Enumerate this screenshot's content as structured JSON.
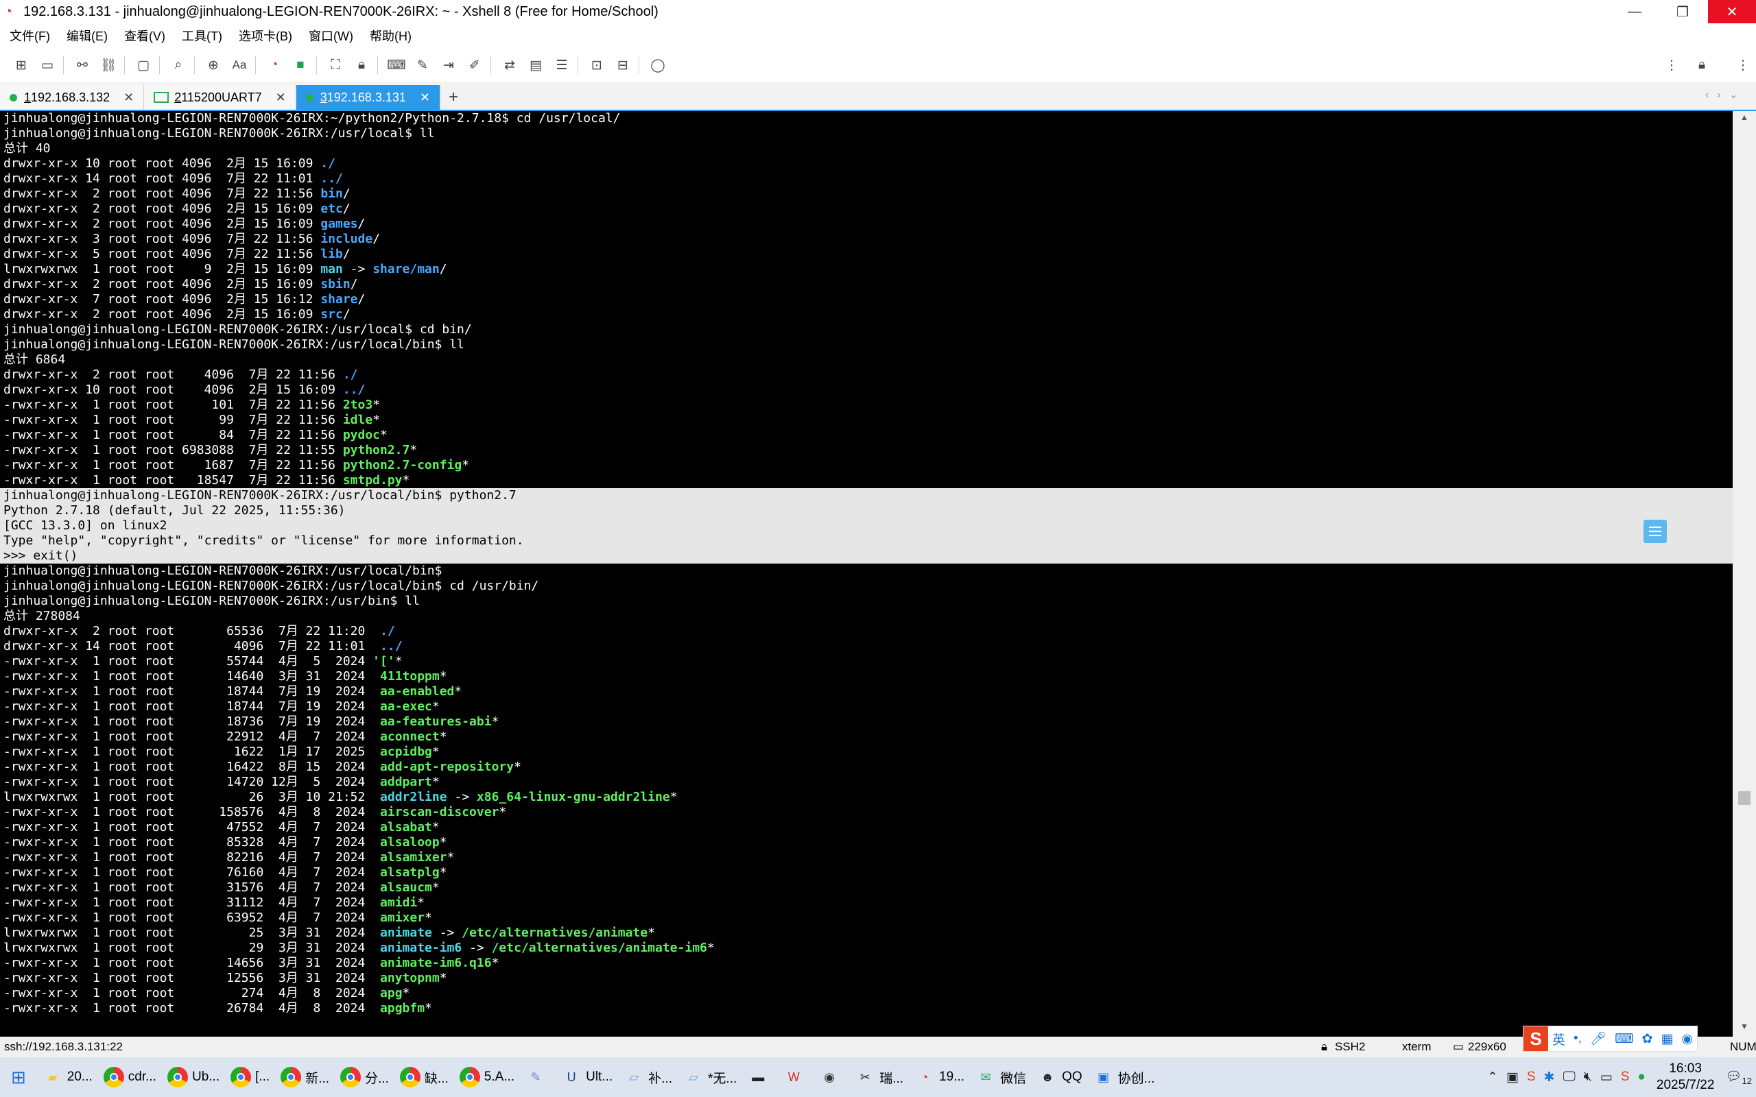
{
  "window": {
    "title": "192.168.3.131 - jinhualong@jinhualong-LEGION-REN7000K-26IRX: ~ - Xshell 8 (Free for Home/School)",
    "minimize": "—",
    "maximize": "❐",
    "close": "✕"
  },
  "menu": [
    "文件(F)",
    "编辑(E)",
    "查看(V)",
    "工具(T)",
    "选项卡(B)",
    "窗口(W)",
    "帮助(H)"
  ],
  "tabs": [
    {
      "num": "1",
      "label": " 192.168.3.132",
      "status": "connected"
    },
    {
      "num": "2",
      "label": " 115200UART7",
      "status": "serial"
    },
    {
      "num": "3",
      "label": " 192.168.3.131",
      "status": "connected",
      "active": true
    }
  ],
  "add_tab": "+",
  "terminal": {
    "lines": [
      [
        {
          "t": "jinhualong@jinhualong-LEGION-REN7000K-26IRX:~/python2/Python-2.7.18$ cd /usr/local/"
        }
      ],
      [
        {
          "t": "jinhualong@jinhualong-LEGION-REN7000K-26IRX:/usr/local$ ll"
        }
      ],
      [
        {
          "t": "总计 40"
        }
      ],
      [
        {
          "t": "drwxr-xr-x 10 root root 4096  2月 15 16:09 "
        },
        {
          "t": "./",
          "c": "dir"
        }
      ],
      [
        {
          "t": "drwxr-xr-x 14 root root 4096  7月 22 11:01 "
        },
        {
          "t": "../",
          "c": "dir"
        }
      ],
      [
        {
          "t": "drwxr-xr-x  2 root root 4096  7月 22 11:56 "
        },
        {
          "t": "bin",
          "c": "dir"
        },
        {
          "t": "/"
        }
      ],
      [
        {
          "t": "drwxr-xr-x  2 root root 4096  2月 15 16:09 "
        },
        {
          "t": "etc",
          "c": "dir"
        },
        {
          "t": "/"
        }
      ],
      [
        {
          "t": "drwxr-xr-x  2 root root 4096  2月 15 16:09 "
        },
        {
          "t": "games",
          "c": "dir"
        },
        {
          "t": "/"
        }
      ],
      [
        {
          "t": "drwxr-xr-x  3 root root 4096  7月 22 11:56 "
        },
        {
          "t": "include",
          "c": "dir"
        },
        {
          "t": "/"
        }
      ],
      [
        {
          "t": "drwxr-xr-x  5 root root 4096  7月 22 11:56 "
        },
        {
          "t": "lib",
          "c": "dir"
        },
        {
          "t": "/"
        }
      ],
      [
        {
          "t": "lrwxrwxrwx  1 root root    9  2月 15 16:09 "
        },
        {
          "t": "man",
          "c": "lnk"
        },
        {
          "t": " -> "
        },
        {
          "t": "share/man",
          "c": "dir"
        },
        {
          "t": "/"
        }
      ],
      [
        {
          "t": "drwxr-xr-x  2 root root 4096  2月 15 16:09 "
        },
        {
          "t": "sbin",
          "c": "dir"
        },
        {
          "t": "/"
        }
      ],
      [
        {
          "t": "drwxr-xr-x  7 root root 4096  2月 15 16:12 "
        },
        {
          "t": "share",
          "c": "dir"
        },
        {
          "t": "/"
        }
      ],
      [
        {
          "t": "drwxr-xr-x  2 root root 4096  2月 15 16:09 "
        },
        {
          "t": "src",
          "c": "dir"
        },
        {
          "t": "/"
        }
      ],
      [
        {
          "t": "jinhualong@jinhualong-LEGION-REN7000K-26IRX:/usr/local$ cd bin/"
        }
      ],
      [
        {
          "t": "jinhualong@jinhualong-LEGION-REN7000K-26IRX:/usr/local/bin$ ll"
        }
      ],
      [
        {
          "t": "总计 6864"
        }
      ],
      [
        {
          "t": "drwxr-xr-x  2 root root    4096  7月 22 11:56 "
        },
        {
          "t": "./",
          "c": "dir"
        }
      ],
      [
        {
          "t": "drwxr-xr-x 10 root root    4096  2月 15 16:09 "
        },
        {
          "t": "../",
          "c": "dir"
        }
      ],
      [
        {
          "t": "-rwxr-xr-x  1 root root     101  7月 22 11:56 "
        },
        {
          "t": "2to3",
          "c": "exe"
        },
        {
          "t": "*"
        }
      ],
      [
        {
          "t": "-rwxr-xr-x  1 root root      99  7月 22 11:56 "
        },
        {
          "t": "idle",
          "c": "exe"
        },
        {
          "t": "*"
        }
      ],
      [
        {
          "t": "-rwxr-xr-x  1 root root      84  7月 22 11:56 "
        },
        {
          "t": "pydoc",
          "c": "exe"
        },
        {
          "t": "*"
        }
      ],
      [
        {
          "t": "-rwxr-xr-x  1 root root 6983088  7月 22 11:55 "
        },
        {
          "t": "python2.7",
          "c": "exe"
        },
        {
          "t": "*"
        }
      ],
      [
        {
          "t": "-rwxr-xr-x  1 root root    1687  7月 22 11:56 "
        },
        {
          "t": "python2.7-config",
          "c": "exe"
        },
        {
          "t": "*"
        }
      ],
      [
        {
          "t": "-rwxr-xr-x  1 root root   18547  7月 22 11:56 "
        },
        {
          "t": "smtpd.py",
          "c": "exe"
        },
        {
          "t": "*"
        }
      ],
      [
        {
          "t": "jinhualong@jinhualong-LEGION-REN7000K-26IRX:/usr/local/bin$ python2.7"
        }
      ],
      [
        {
          "t": "Python 2.7.18 (default, Jul 22 2025, 11:55:36)"
        }
      ],
      [
        {
          "t": "[GCC 13.3.0] on linux2"
        }
      ],
      [
        {
          "t": "Type \"help\", \"copyright\", \"credits\" or \"license\" for more information."
        }
      ],
      [
        {
          "t": ">>> exit()"
        }
      ],
      [
        {
          "t": "jinhualong@jinhualong-LEGION-REN7000K-26IRX:/usr/local/bin$"
        }
      ],
      [
        {
          "t": "jinhualong@jinhualong-LEGION-REN7000K-26IRX:/usr/local/bin$ cd /usr/bin/"
        }
      ],
      [
        {
          "t": "jinhualong@jinhualong-LEGION-REN7000K-26IRX:/usr/bin$ ll"
        }
      ],
      [
        {
          "t": "总计 278084"
        }
      ],
      [
        {
          "t": "drwxr-xr-x  2 root root       65536  7月 22 11:20  "
        },
        {
          "t": "./",
          "c": "dir"
        }
      ],
      [
        {
          "t": "drwxr-xr-x 14 root root        4096  7月 22 11:01  "
        },
        {
          "t": "../",
          "c": "dir"
        }
      ],
      [
        {
          "t": "-rwxr-xr-x  1 root root       55744  4月  5  2024 "
        },
        {
          "t": "'['",
          "c": "exe"
        },
        {
          "t": "*"
        }
      ],
      [
        {
          "t": "-rwxr-xr-x  1 root root       14640  3月 31  2024  "
        },
        {
          "t": "411toppm",
          "c": "exe"
        },
        {
          "t": "*"
        }
      ],
      [
        {
          "t": "-rwxr-xr-x  1 root root       18744  7月 19  2024  "
        },
        {
          "t": "aa-enabled",
          "c": "exe"
        },
        {
          "t": "*"
        }
      ],
      [
        {
          "t": "-rwxr-xr-x  1 root root       18744  7月 19  2024  "
        },
        {
          "t": "aa-exec",
          "c": "exe"
        },
        {
          "t": "*"
        }
      ],
      [
        {
          "t": "-rwxr-xr-x  1 root root       18736  7月 19  2024  "
        },
        {
          "t": "aa-features-abi",
          "c": "exe"
        },
        {
          "t": "*"
        }
      ],
      [
        {
          "t": "-rwxr-xr-x  1 root root       22912  4月  7  2024  "
        },
        {
          "t": "aconnect",
          "c": "exe"
        },
        {
          "t": "*"
        }
      ],
      [
        {
          "t": "-rwxr-xr-x  1 root root        1622  1月 17  2025  "
        },
        {
          "t": "acpidbg",
          "c": "exe"
        },
        {
          "t": "*"
        }
      ],
      [
        {
          "t": "-rwxr-xr-x  1 root root       16422  8月 15  2024  "
        },
        {
          "t": "add-apt-repository",
          "c": "exe"
        },
        {
          "t": "*"
        }
      ],
      [
        {
          "t": "-rwxr-xr-x  1 root root       14720 12月  5  2024  "
        },
        {
          "t": "addpart",
          "c": "exe"
        },
        {
          "t": "*"
        }
      ],
      [
        {
          "t": "lrwxrwxrwx  1 root root          26  3月 10 21:52  "
        },
        {
          "t": "addr2line",
          "c": "lnk"
        },
        {
          "t": " -> "
        },
        {
          "t": "x86_64-linux-gnu-addr2line",
          "c": "exe"
        },
        {
          "t": "*"
        }
      ],
      [
        {
          "t": "-rwxr-xr-x  1 root root      158576  4月  8  2024  "
        },
        {
          "t": "airscan-discover",
          "c": "exe"
        },
        {
          "t": "*"
        }
      ],
      [
        {
          "t": "-rwxr-xr-x  1 root root       47552  4月  7  2024  "
        },
        {
          "t": "alsabat",
          "c": "exe"
        },
        {
          "t": "*"
        }
      ],
      [
        {
          "t": "-rwxr-xr-x  1 root root       85328  4月  7  2024  "
        },
        {
          "t": "alsaloop",
          "c": "exe"
        },
        {
          "t": "*"
        }
      ],
      [
        {
          "t": "-rwxr-xr-x  1 root root       82216  4月  7  2024  "
        },
        {
          "t": "alsamixer",
          "c": "exe"
        },
        {
          "t": "*"
        }
      ],
      [
        {
          "t": "-rwxr-xr-x  1 root root       76160  4月  7  2024  "
        },
        {
          "t": "alsatplg",
          "c": "exe"
        },
        {
          "t": "*"
        }
      ],
      [
        {
          "t": "-rwxr-xr-x  1 root root       31576  4月  7  2024  "
        },
        {
          "t": "alsaucm",
          "c": "exe"
        },
        {
          "t": "*"
        }
      ],
      [
        {
          "t": "-rwxr-xr-x  1 root root       31112  4月  7  2024  "
        },
        {
          "t": "amidi",
          "c": "exe"
        },
        {
          "t": "*"
        }
      ],
      [
        {
          "t": "-rwxr-xr-x  1 root root       63952  4月  7  2024  "
        },
        {
          "t": "amixer",
          "c": "exe"
        },
        {
          "t": "*"
        }
      ],
      [
        {
          "t": "lrwxrwxrwx  1 root root          25  3月 31  2024  "
        },
        {
          "t": "animate",
          "c": "lnk"
        },
        {
          "t": " -> "
        },
        {
          "t": "/etc/alternatives/animate",
          "c": "exe"
        },
        {
          "t": "*"
        }
      ],
      [
        {
          "t": "lrwxrwxrwx  1 root root          29  3月 31  2024  "
        },
        {
          "t": "animate-im6",
          "c": "lnk"
        },
        {
          "t": " -> "
        },
        {
          "t": "/etc/alternatives/animate-im6",
          "c": "exe"
        },
        {
          "t": "*"
        }
      ],
      [
        {
          "t": "-rwxr-xr-x  1 root root       14656  3月 31  2024  "
        },
        {
          "t": "animate-im6.q16",
          "c": "exe"
        },
        {
          "t": "*"
        }
      ],
      [
        {
          "t": "-rwxr-xr-x  1 root root       12556  3月 31  2024  "
        },
        {
          "t": "anytopnm",
          "c": "exe"
        },
        {
          "t": "*"
        }
      ],
      [
        {
          "t": "-rwxr-xr-x  1 root root         274  4月  8  2024  "
        },
        {
          "t": "apg",
          "c": "exe"
        },
        {
          "t": "*"
        }
      ],
      [
        {
          "t": "-rwxr-xr-x  1 root root       26784  4月  8  2024  "
        },
        {
          "t": "apgbfm",
          "c": "exe"
        },
        {
          "t": "*"
        }
      ]
    ],
    "selected_range": [
      25,
      29
    ]
  },
  "statusbar": {
    "connection": "ssh://192.168.3.131:22",
    "protocol": "SSH2",
    "term": "xterm",
    "size": "229x60",
    "num": "NUM"
  },
  "ime": {
    "lang": "英"
  },
  "taskbar": {
    "items": [
      {
        "icon": "folder-icon",
        "label": "20..."
      },
      {
        "icon": "chrome-icon",
        "label": "cdr..."
      },
      {
        "icon": "chrome-icon",
        "label": "Ub..."
      },
      {
        "icon": "chrome-icon",
        "label": "[..."
      },
      {
        "icon": "chrome-icon",
        "label": "新..."
      },
      {
        "icon": "chrome-icon",
        "label": "分..."
      },
      {
        "icon": "chrome-icon",
        "label": "缺..."
      },
      {
        "icon": "chrome-icon",
        "label": "5.A..."
      },
      {
        "icon": "tool-icon",
        "label": ""
      },
      {
        "icon": "ultraedit-icon",
        "label": "Ult..."
      },
      {
        "icon": "notepad-icon",
        "label": "补..."
      },
      {
        "icon": "notepad-icon",
        "label": "*无..."
      },
      {
        "icon": "terminal-icon",
        "label": ""
      },
      {
        "icon": "wps-icon",
        "label": ""
      },
      {
        "icon": "camera-icon",
        "label": ""
      },
      {
        "icon": "tools-icon",
        "label": "瑞..."
      },
      {
        "icon": "xshell-icon",
        "label": "19..."
      },
      {
        "icon": "wechat-icon",
        "label": "微信"
      },
      {
        "icon": "qq-icon",
        "label": "QQ"
      },
      {
        "icon": "collab-icon",
        "label": "协创..."
      }
    ],
    "time": "16:03",
    "date": "2025/7/22",
    "notify_count": "12"
  }
}
